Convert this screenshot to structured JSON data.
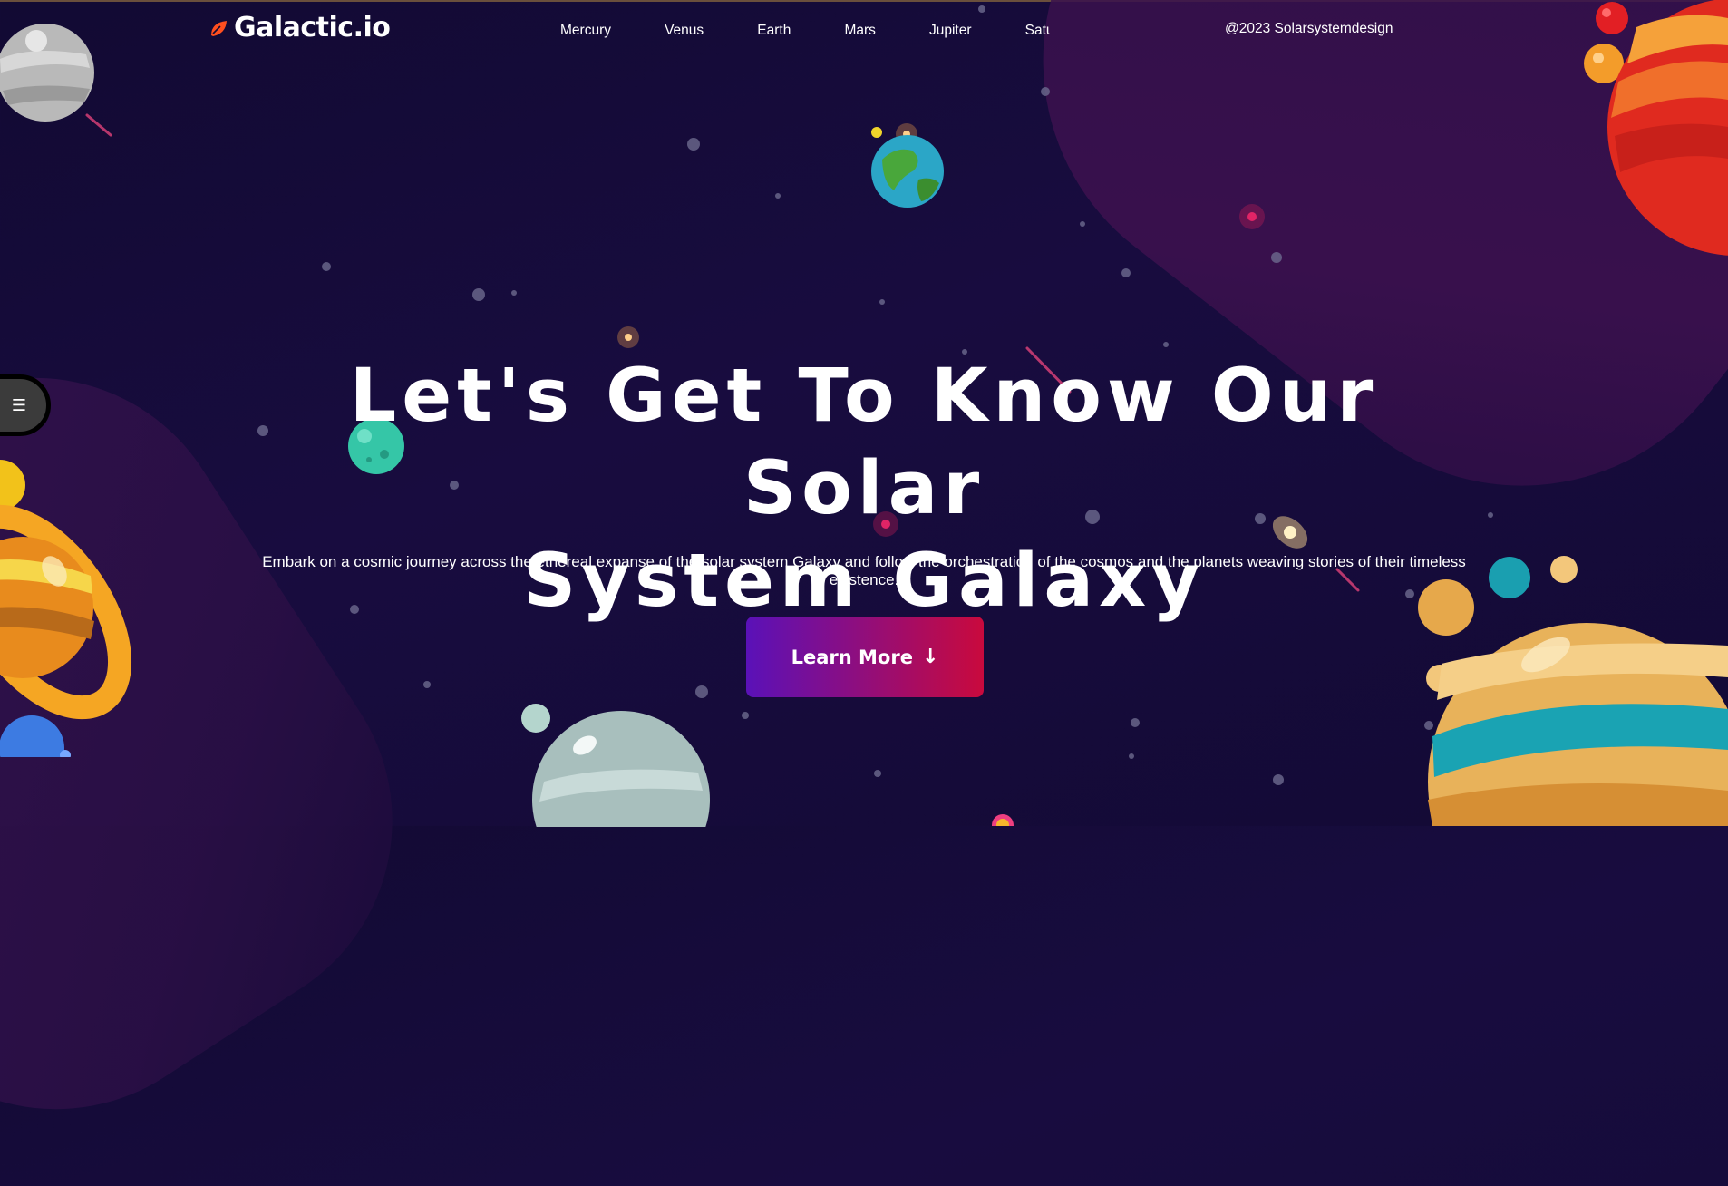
{
  "header": {
    "logo_text": "Galactic.io",
    "nav": [
      "Mercury",
      "Venus",
      "Earth",
      "Mars",
      "Jupiter",
      "Saturn"
    ],
    "copyright": "@2023 Solarsystemdesign"
  },
  "hero": {
    "title_line1": "Let's Get To Know Our Solar",
    "title_line2": "System Galaxy",
    "subtitle": "Embark on a cosmic journey across the ethereal expanse of the solar system Galaxy and follow the orchestration of the cosmos and the planets weaving stories of their timeless existence.",
    "cta_label": "Learn More",
    "cta_icon": "arrow-down-icon"
  },
  "menu_toggle": {
    "icon": "hamburger-icon",
    "glyph": "☰"
  },
  "colors": {
    "background": "#150b39",
    "accent_orange": "#ff4f1f",
    "cta_start": "#5a11b8",
    "cta_end": "#c90a3d"
  }
}
